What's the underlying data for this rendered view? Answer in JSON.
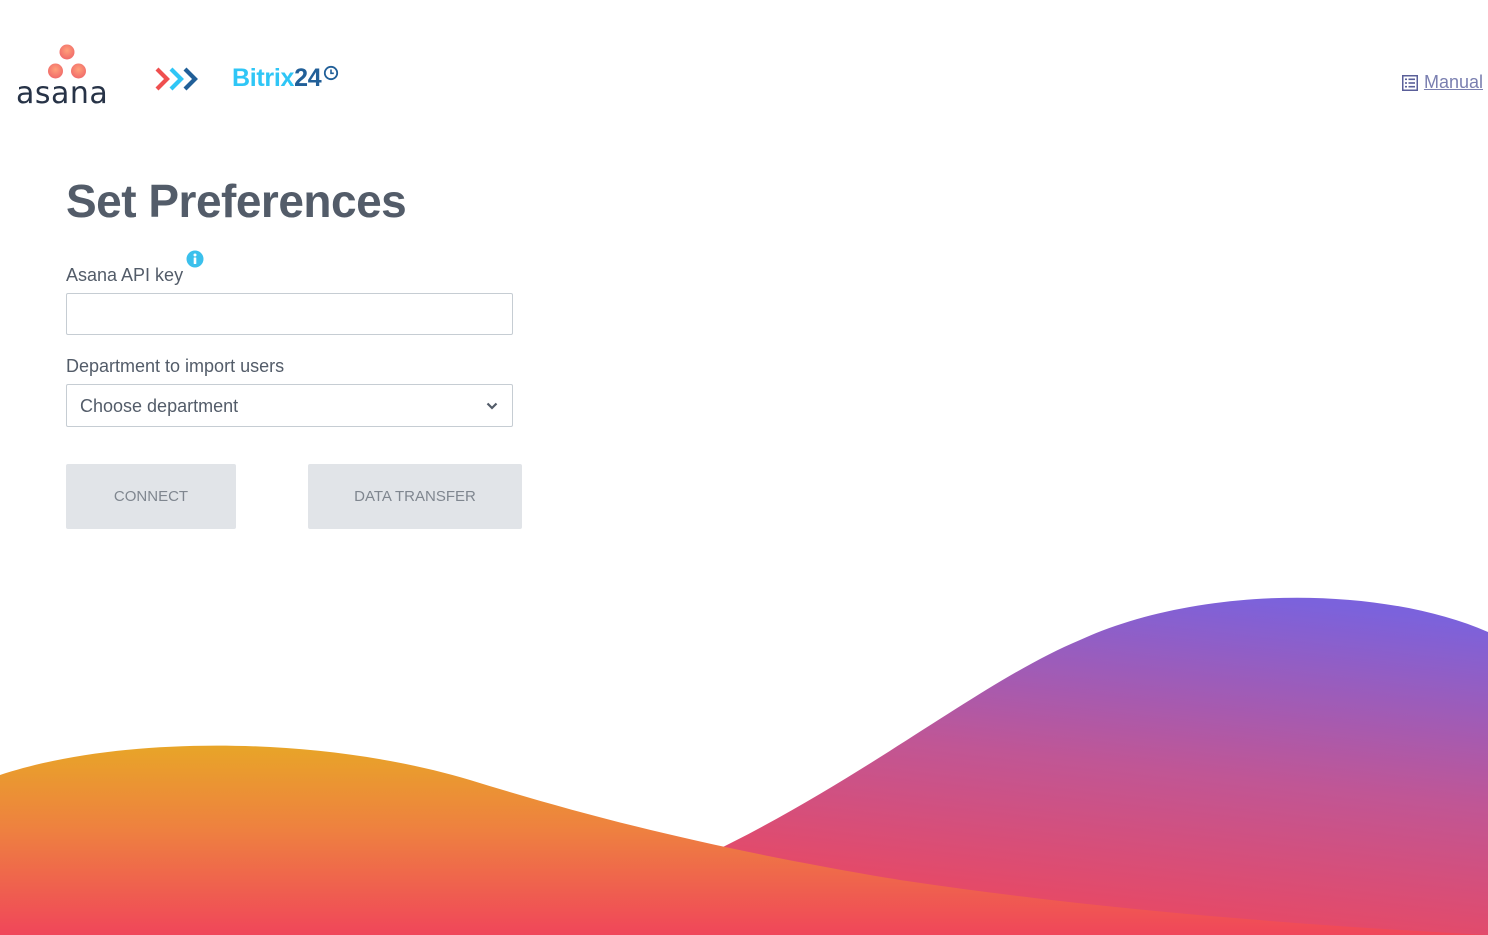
{
  "header": {
    "asana_logo_text": "asana",
    "bitrix_logo_text": "Bitrix",
    "bitrix_logo_number": "24",
    "manual_link": "Manual",
    "manual_icon": "list-book-icon",
    "arrows_icon": "triple-chevron-right-icon",
    "clock_icon": "clock-icon"
  },
  "main": {
    "title": "Set Preferences",
    "api_key_label": "Asana API key",
    "api_key_value": "",
    "api_key_placeholder": "",
    "info_icon": "info-icon",
    "department_label": "Department to import users",
    "department_selected": "Choose department",
    "connect_button": "CONNECT",
    "transfer_button": "DATA TRANSFER"
  },
  "colors": {
    "asana_dot": "#f06a6a",
    "bitrix_blue": "#2fc6f6",
    "bitrix_dark": "#215f98",
    "title_text": "#535c69",
    "button_bg": "#e1e4e8",
    "wave_orange": "#e8a22a",
    "wave_red": "#f0465a",
    "wave_purple": "#7b62dc"
  }
}
